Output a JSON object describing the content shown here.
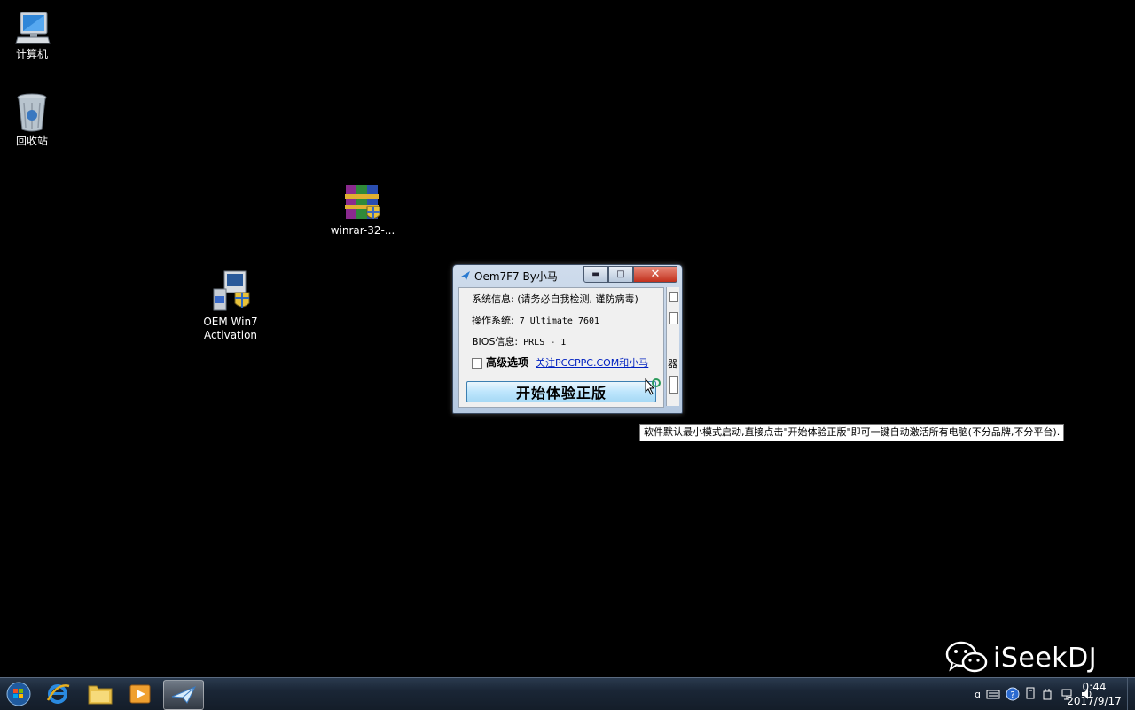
{
  "desktop": {
    "icons": [
      {
        "label": "计算机",
        "icon": "computer-icon"
      },
      {
        "label": "回收站",
        "icon": "recycle-bin-icon"
      },
      {
        "label": "winrar-32-...",
        "icon": "winrar-icon"
      },
      {
        "label_line1": "OEM Win7",
        "label_line2": "Activation",
        "icon": "setup-icon"
      }
    ]
  },
  "window": {
    "title": "Oem7F7 By小马",
    "system_info_label": "系统信息: (请务必自我检测, 谨防病毒)",
    "os_label": "操作系统:",
    "os_value": "7 Ultimate 7601",
    "bios_label": "BIOS信息:",
    "bios_value": "PRLS   - 1",
    "advanced_label": "高级选项",
    "link_text": "关注PCCPPC.COM和小马",
    "start_button": "开始体验正版",
    "side_char": "器"
  },
  "tooltip": "软件默认最小模式启动,直接点击\"开始体验正版\"即可一键自动激活所有电脑(不分品牌,不分平台).",
  "watermark": "iSeekDJ",
  "taskbar": {
    "time": "0:44",
    "date": "2017/9/17",
    "tray_marker": "ɑ"
  },
  "colors": {
    "taskbar": "#1a2636",
    "close_button": "#c2301c",
    "start_button": "#bee6fd",
    "link": "#0020c0"
  }
}
